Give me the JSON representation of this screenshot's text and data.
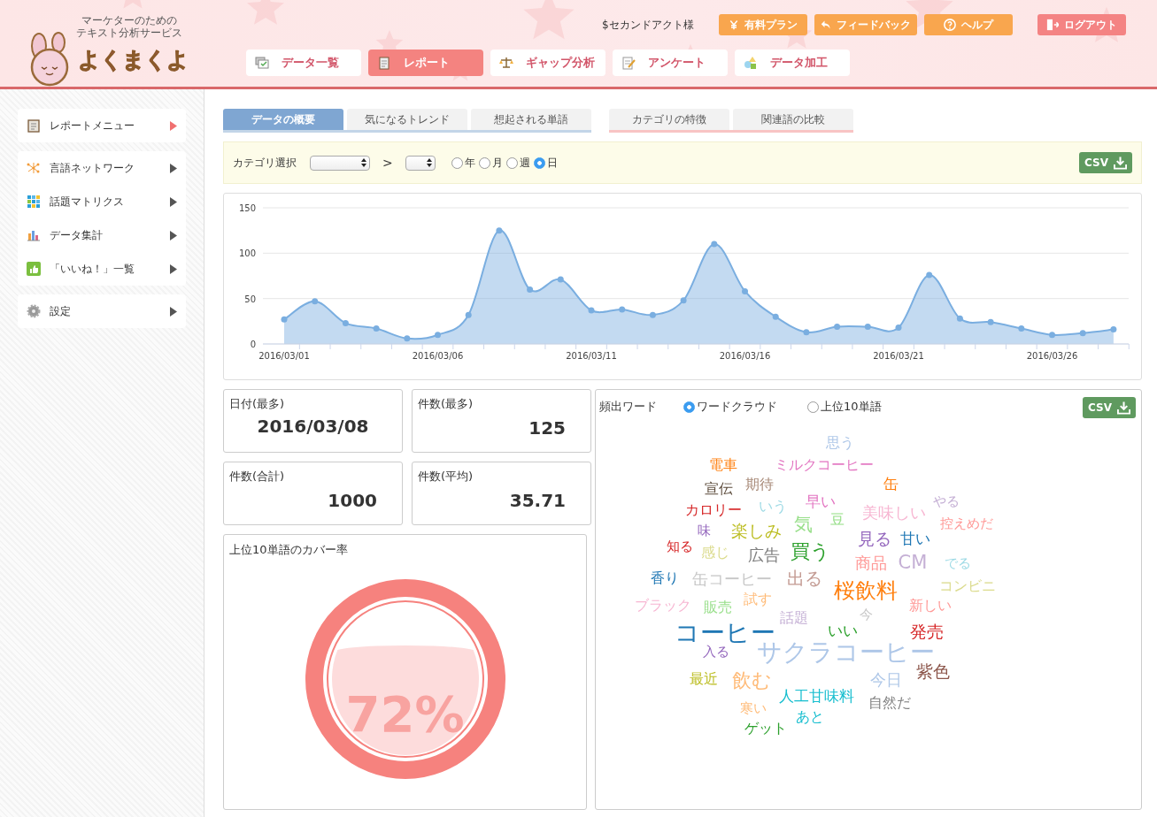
{
  "header": {
    "logo": {
      "tagline_1": "マーケターのための",
      "tagline_2": "テキスト分析サービス",
      "name": "よくまくよ"
    },
    "user": "$セカンドアクト様",
    "buttons": [
      {
        "label": "有料プラン",
        "kind": "plan"
      },
      {
        "label": "フィードバック",
        "kind": "feedback"
      },
      {
        "label": "ヘルプ",
        "kind": "help"
      },
      {
        "label": "ログアウト",
        "kind": "logout"
      }
    ],
    "nav": [
      {
        "label": "データ一覧",
        "selected": false
      },
      {
        "label": "レポート",
        "selected": true
      },
      {
        "label": "ギャップ分析",
        "selected": false
      },
      {
        "label": "アンケート",
        "selected": false
      },
      {
        "label": "データ加工",
        "selected": false
      }
    ]
  },
  "sidebar": {
    "groups": [
      [
        {
          "label": "レポートメニュー",
          "selected": true
        }
      ],
      [
        {
          "label": "言語ネットワーク",
          "selected": false
        },
        {
          "label": "話題マトリクス",
          "selected": false
        },
        {
          "label": "データ集計",
          "selected": false
        },
        {
          "label": "「いいね！」一覧",
          "selected": false
        }
      ],
      [
        {
          "label": "設定",
          "selected": false
        }
      ]
    ]
  },
  "tab_groups": [
    [
      {
        "label": "データの概要",
        "selected": true
      },
      {
        "label": "気になるトレンド",
        "selected": false
      },
      {
        "label": "想起される単語",
        "selected": false
      }
    ],
    [
      {
        "label": "カテゴリの特徴",
        "selected": false
      },
      {
        "label": "関連語の比較",
        "selected": false
      }
    ]
  ],
  "filter": {
    "label": "カテゴリ選択",
    "separator": ">",
    "periods": [
      {
        "label": "年",
        "selected": false
      },
      {
        "label": "月",
        "selected": false
      },
      {
        "label": "週",
        "selected": false
      },
      {
        "label": "日",
        "selected": true
      }
    ],
    "csv": "CSV"
  },
  "chart_data": {
    "type": "area",
    "categories": [
      "2016/03/01",
      null,
      null,
      null,
      null,
      "2016/03/06",
      null,
      null,
      null,
      null,
      "2016/03/11",
      null,
      null,
      null,
      null,
      "2016/03/16",
      null,
      null,
      null,
      null,
      "2016/03/21",
      null,
      null,
      null,
      null,
      "2016/03/26",
      null,
      null
    ],
    "series": [
      {
        "color": "#7aaee0",
        "values": [
          27,
          47,
          23,
          17,
          6,
          10,
          32,
          125,
          60,
          71,
          37,
          38,
          32,
          48,
          110,
          58,
          30,
          13,
          19,
          19,
          18,
          76,
          28,
          24,
          17,
          10,
          12,
          16
        ]
      }
    ],
    "ylim": [
      0,
      150
    ],
    "yticks": [
      0,
      50,
      100,
      150
    ]
  },
  "stats": [
    {
      "label": "日付(最多)",
      "value": "2016/03/08"
    },
    {
      "label": "件数(最多)",
      "value": "125"
    },
    {
      "label": "件数(合計)",
      "value": "1000"
    },
    {
      "label": "件数(平均)",
      "value": "35.71"
    }
  ],
  "coverage": {
    "title": "上位10単語のカバー率",
    "value": "72%",
    "level": 0.72
  },
  "words_panel": {
    "title": "頻出ワード",
    "modes": [
      {
        "label": "ワードクラウド",
        "selected": true
      },
      {
        "label": "上位10単語",
        "selected": false
      }
    ],
    "csv": "CSV",
    "words": [
      {
        "text": "思う",
        "color": "#aec7e8"
      },
      {
        "text": "電車",
        "color": "#ff7f0e"
      },
      {
        "text": "ミルクコーヒー",
        "color": "#e377c2"
      },
      {
        "text": "宣伝",
        "color": "#5b4a3a"
      },
      {
        "text": "期待",
        "color": "#a88a78"
      },
      {
        "text": "缶",
        "color": "#ff7f0e"
      },
      {
        "text": "やる",
        "color": "#c5b0d5"
      },
      {
        "text": "カロリー",
        "color": "#d62728"
      },
      {
        "text": "いう",
        "color": "#9edae5"
      },
      {
        "text": "早い",
        "color": "#e377c2"
      },
      {
        "text": "豆",
        "color": "#98df8a"
      },
      {
        "text": "美味しい",
        "color": "#f7b6d2"
      },
      {
        "text": "控えめだ",
        "color": "#ff9896"
      },
      {
        "text": "味",
        "color": "#9467bd"
      },
      {
        "text": "楽しみ",
        "color": "#bcbd22"
      },
      {
        "text": "気",
        "color": "#98df8a"
      },
      {
        "text": "知る",
        "color": "#d62728"
      },
      {
        "text": "見る",
        "color": "#9467bd"
      },
      {
        "text": "甘い",
        "color": "#1f77b4"
      },
      {
        "text": "感じ",
        "color": "#dbdb8d"
      },
      {
        "text": "広告",
        "color": "#7f7f7f"
      },
      {
        "text": "買う",
        "color": "#2ca02c"
      },
      {
        "text": "商品",
        "color": "#ff9896"
      },
      {
        "text": "CM",
        "color": "#c5b0d5"
      },
      {
        "text": "でる",
        "color": "#9edae5"
      },
      {
        "text": "香り",
        "color": "#1f77b4"
      },
      {
        "text": "缶コーヒー",
        "color": "#c7c7c7"
      },
      {
        "text": "出る",
        "color": "#c49c94"
      },
      {
        "text": "桜飲料",
        "color": "#ff7f0e"
      },
      {
        "text": "コンビニ",
        "color": "#dbdb8d"
      },
      {
        "text": "ブラック",
        "color": "#f7b6d2"
      },
      {
        "text": "販売",
        "color": "#98df8a"
      },
      {
        "text": "試す",
        "color": "#ffbb78"
      },
      {
        "text": "新しい",
        "color": "#ff9896"
      },
      {
        "text": "話題",
        "color": "#c5b0d5"
      },
      {
        "text": "今",
        "color": "#c7c7c7"
      },
      {
        "text": "コーヒー",
        "color": "#1f77b4"
      },
      {
        "text": "いい",
        "color": "#2ca02c"
      },
      {
        "text": "発売",
        "color": "#d62728"
      },
      {
        "text": "入る",
        "color": "#9467bd"
      },
      {
        "text": "サクラコーヒー",
        "color": "#aec7e8"
      },
      {
        "text": "紫色",
        "color": "#8c564b"
      },
      {
        "text": "最近",
        "color": "#bcbd22"
      },
      {
        "text": "飲む",
        "color": "#ffbb78"
      },
      {
        "text": "今日",
        "color": "#aec7e8"
      },
      {
        "text": "人工甘味料",
        "color": "#17becf"
      },
      {
        "text": "寒い",
        "color": "#ffbb78"
      },
      {
        "text": "自然だ",
        "color": "#7f7f7f"
      },
      {
        "text": "あと",
        "color": "#17becf"
      },
      {
        "text": "ゲット",
        "color": "#2ca02c"
      }
    ]
  }
}
